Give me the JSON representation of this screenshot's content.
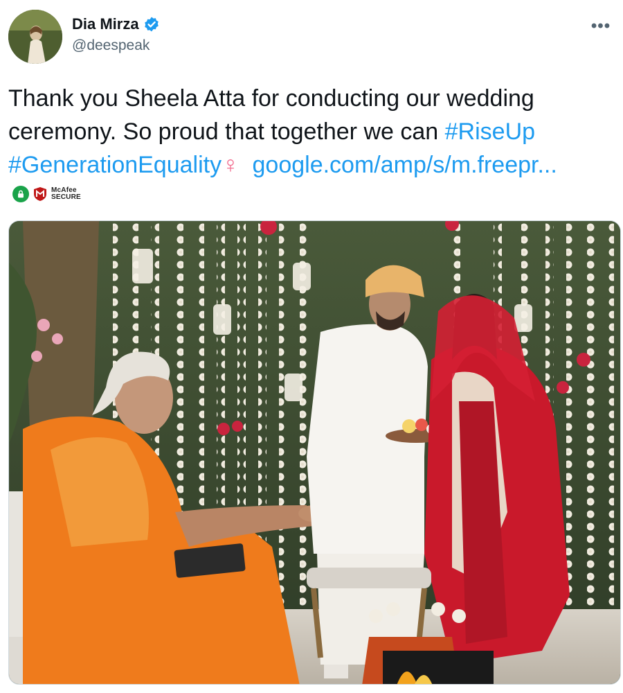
{
  "author": {
    "display_name": "Dia Mirza",
    "handle": "@deespeak",
    "verified": true
  },
  "tweet": {
    "text_plain": "Thank you Sheela Atta for conducting our wedding ceremony. So proud that together we can ",
    "hashtag_1": "#RiseUp",
    "hashtag_2": "#GenerationEquality",
    "emoji": "♀",
    "link": "google.com/amp/s/m.freepr..."
  },
  "more_label": "•••",
  "security_badge": {
    "brand": "McAfee",
    "label": "SECURE"
  },
  "icons": {
    "verified": "verified-badge-icon",
    "more": "more-icon",
    "lock": "lock-icon"
  },
  "colors": {
    "link": "#1d9bf0",
    "text": "#0f1419",
    "secondary": "#536471",
    "verified": "#1d9bf0",
    "badge_green": "#1aa34a",
    "mcafee_red": "#c01818"
  }
}
